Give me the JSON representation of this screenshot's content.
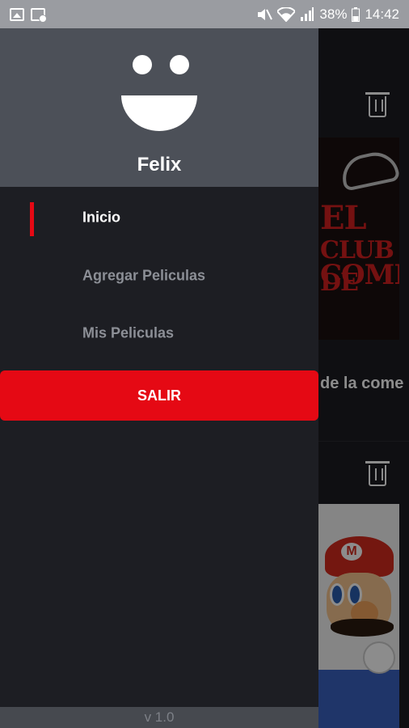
{
  "status_bar": {
    "left_icons": [
      "image-icon",
      "image-sync-icon"
    ],
    "right_icons": [
      "mute-icon",
      "wifi-icon",
      "signal-icon"
    ],
    "battery": "38%",
    "battery_icon": "battery-icon",
    "time": "14:42"
  },
  "drawer": {
    "avatar_icon": "smiley-icon",
    "user_name": "Felix",
    "menu": [
      {
        "label": "Inicio",
        "active": true
      },
      {
        "label": "Agregar Peliculas",
        "active": false
      },
      {
        "label": "Mis Peliculas",
        "active": false
      }
    ],
    "logout_label": "SALIR",
    "version": "v 1.0"
  },
  "background": {
    "card_caption": "de la come",
    "poster1_text": [
      "EL",
      "CLUB DE",
      "COMEDIA"
    ]
  },
  "colors": {
    "accent": "#e50914",
    "header": "#4c5058",
    "drawer_bg": "#1d1e23"
  }
}
